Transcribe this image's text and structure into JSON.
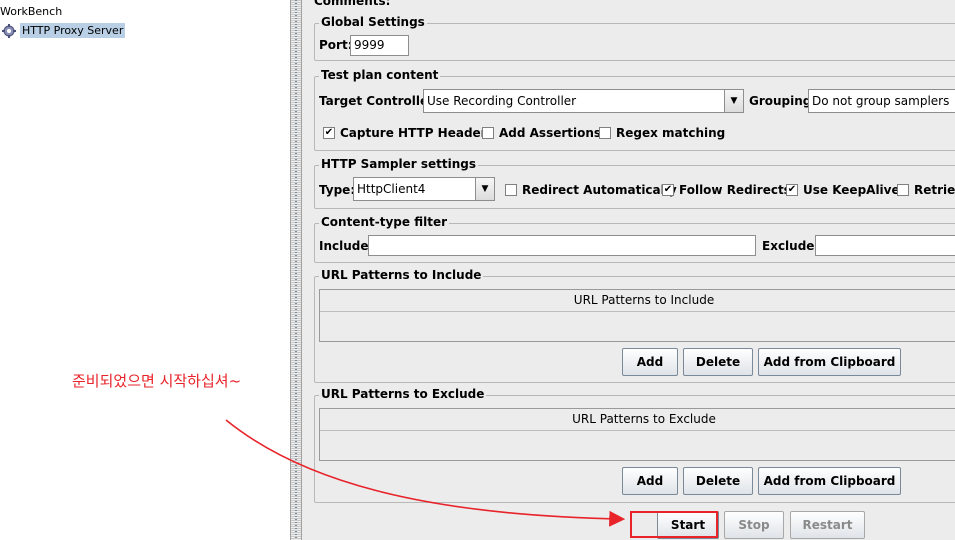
{
  "tree": {
    "workbench": "WorkBench",
    "proxy_server": "HTTP Proxy Server"
  },
  "panel": {
    "comments_label": "Comments:",
    "global_settings": {
      "legend": "Global Settings",
      "port_label": "Port:",
      "port_value": "9999"
    },
    "test_plan": {
      "legend": "Test plan content",
      "target_label": "Target Controller:",
      "target_value": "Use Recording Controller",
      "grouping_label": "Grouping:",
      "grouping_value": "Do not group samplers",
      "capture_headers": {
        "label": "Capture HTTP Headers",
        "checked": true
      },
      "add_assertions": {
        "label": "Add Assertions",
        "checked": false
      },
      "regex_matching": {
        "label": "Regex matching",
        "checked": false
      }
    },
    "sampler": {
      "legend": "HTTP Sampler settings",
      "type_label": "Type:",
      "type_value": "HttpClient4",
      "redirect_auto": {
        "label": "Redirect Automatically",
        "checked": false
      },
      "follow_redirects": {
        "label": "Follow Redirects",
        "checked": true
      },
      "keepalive": {
        "label": "Use KeepAlive",
        "checked": true
      },
      "retrieve": {
        "label": "Retrieve",
        "checked": false
      }
    },
    "content_filter": {
      "legend": "Content-type filter",
      "include_label": "Include:",
      "include_value": "",
      "exclude_label": "Exclude:",
      "exclude_value": ""
    },
    "include_patterns": {
      "legend": "URL Patterns to Include",
      "column": "URL Patterns to Include",
      "add": "Add",
      "delete": "Delete",
      "clipboard": "Add from Clipboard"
    },
    "exclude_patterns": {
      "legend": "URL Patterns to Exclude",
      "column": "URL Patterns to Exclude",
      "add": "Add",
      "delete": "Delete",
      "clipboard": "Add from Clipboard"
    },
    "controls": {
      "start": "Start",
      "stop": "Stop",
      "restart": "Restart"
    }
  },
  "annotation": {
    "text": "준비되었으면 시작하십셔~",
    "color": "#e8232a"
  },
  "icons": {
    "proxy": "proxy-gear-icon",
    "dropdown": "chevron-down-icon",
    "check": "checkmark-icon"
  }
}
